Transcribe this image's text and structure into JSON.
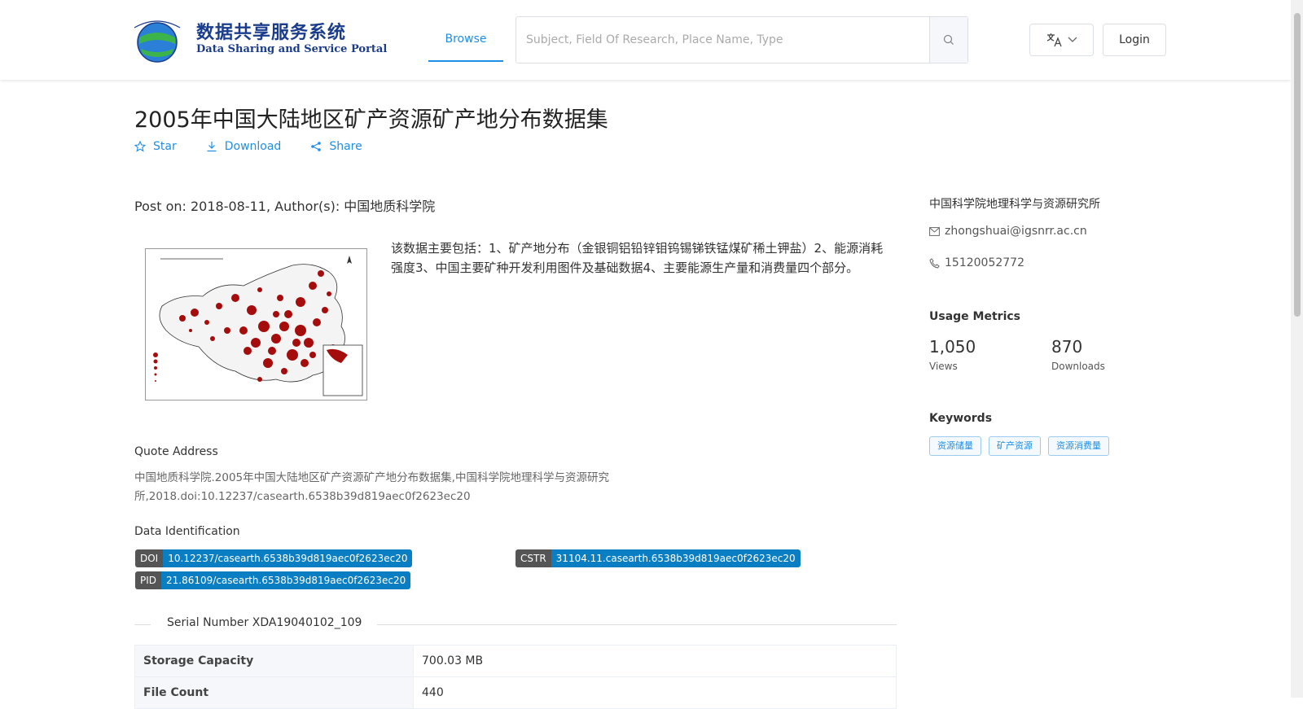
{
  "header": {
    "logo_cn": "数据共享服务系统",
    "logo_en": "Data Sharing and Service Portal",
    "nav_browse": "Browse",
    "search_placeholder": "Subject, Field Of Research, Place Name, Type",
    "login": "Login"
  },
  "dataset": {
    "title": "2005年中国大陆地区矿产资源矿产地分布数据集",
    "actions": {
      "star": "Star",
      "download": "Download",
      "share": "Share"
    },
    "post_info": "Post on: 2018-08-11, Author(s): 中国地质科学院",
    "description": "该数据主要包括：1、矿产地分布（金银铜铝铅锌钼钨锡锑铁锰煤矿稀土钾盐）2、能源消耗强度3、中国主要矿种开发利用图件及基础数据4、主要能源生产量和消费量四个部分。",
    "quote_label": "Quote Address",
    "quote_text": "中国地质科学院.2005年中国大陆地区矿产资源矿产地分布数据集,中国科学院地理科学与资源研究所,2018.doi:10.12237/casearth.6538b39d819aec0f2623ec20",
    "identification_label": "Data Identification",
    "identifiers": {
      "doi_key": "DOI",
      "doi_value": "10.12237/casearth.6538b39d819aec0f2623ec20",
      "cstr_key": "CSTR",
      "cstr_value": "31104.11.casearth.6538b39d819aec0f2623ec20",
      "pid_key": "PID",
      "pid_value": "21.86109/casearth.6538b39d819aec0f2623ec20"
    },
    "serial": "Serial Number XDA19040102_109",
    "table": [
      {
        "key": "Storage Capacity",
        "value": "700.03 MB"
      },
      {
        "key": "File Count",
        "value": "440"
      }
    ]
  },
  "sidebar": {
    "org": "中国科学院地理科学与资源研究所",
    "email": "zhongshuai@igsnrr.ac.cn",
    "phone": "15120052772",
    "metrics_title": "Usage Metrics",
    "views_value": "1,050",
    "views_label": "Views",
    "downloads_value": "870",
    "downloads_label": "Downloads",
    "keywords_title": "Keywords",
    "keywords": [
      "资源储量",
      "矿产资源",
      "资源消费量"
    ]
  },
  "colors": {
    "accent": "#1f8ee6",
    "tag_value_bg": "#0a7ec2",
    "tag_key_bg": "#555555"
  }
}
